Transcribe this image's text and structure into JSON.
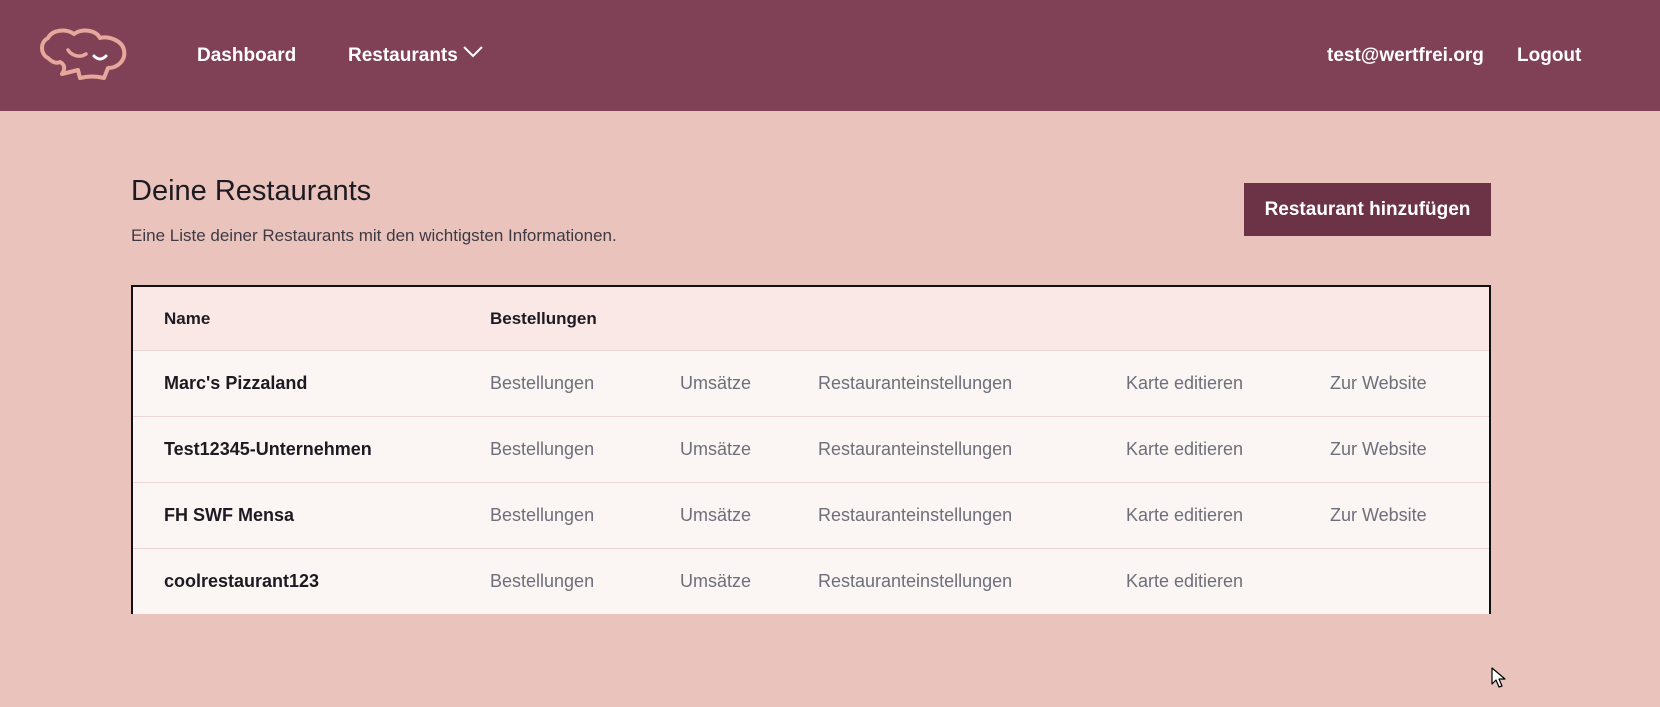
{
  "nav": {
    "dashboard": "Dashboard",
    "restaurants": "Restaurants",
    "email": "test@wertfrei.org",
    "logout": "Logout"
  },
  "header": {
    "title": "Deine Restaurants",
    "subtitle": "Eine Liste deiner Restaurants mit den wichtigsten Informationen.",
    "add_button": "Restaurant hinzufügen"
  },
  "table": {
    "columns": [
      "Name",
      "Bestellungen"
    ],
    "rows": [
      {
        "name": "Marc's Pizzaland",
        "orders": "Bestellungen",
        "revenue": "Umsätze",
        "settings": "Restauranteinstellungen",
        "menu": "Karte editieren",
        "website": "Zur Website"
      },
      {
        "name": "Test12345-Unternehmen",
        "orders": "Bestellungen",
        "revenue": "Umsätze",
        "settings": "Restauranteinstellungen",
        "menu": "Karte editieren",
        "website": "Zur Website"
      },
      {
        "name": "FH SWF Mensa",
        "orders": "Bestellungen",
        "revenue": "Umsätze",
        "settings": "Restauranteinstellungen",
        "menu": "Karte editieren",
        "website": "Zur Website"
      },
      {
        "name": "coolrestaurant123",
        "orders": "Bestellungen",
        "revenue": "Umsätze",
        "settings": "Restauranteinstellungen",
        "menu": "Karte editieren",
        "website": ""
      }
    ]
  },
  "colors": {
    "navbar": "#804157",
    "background": "#e9c3bc",
    "button": "#6c3347",
    "logo": "#e6a79d"
  },
  "icons": {
    "logo": "chef-hat-icon",
    "dropdown": "chevron-down-icon",
    "cursor": "mouse-pointer-icon"
  }
}
